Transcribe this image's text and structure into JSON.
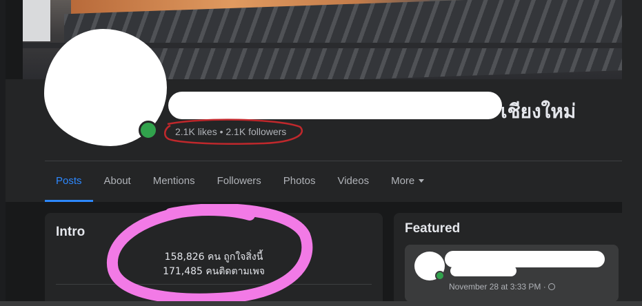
{
  "profile": {
    "name_visible": "เชียงใหม่",
    "stats": "2.1K likes • 2.1K followers"
  },
  "tabs": [
    {
      "label": "Posts",
      "active": true
    },
    {
      "label": "About"
    },
    {
      "label": "Mentions"
    },
    {
      "label": "Followers"
    },
    {
      "label": "Photos"
    },
    {
      "label": "Videos"
    },
    {
      "label": "More"
    }
  ],
  "intro": {
    "title": "Intro",
    "likes_line": "158,826 คน ถูกใจสิ่งนี้",
    "followers_line": "171,485 คนติดตามเพจ"
  },
  "featured": {
    "title": "Featured",
    "post_date": "November 28 at 3:33 PM ·"
  },
  "colors": {
    "accent": "#2d88ff",
    "online": "#31a24c",
    "annotation_red": "#c0282c",
    "annotation_pink": "#f27ae6"
  }
}
